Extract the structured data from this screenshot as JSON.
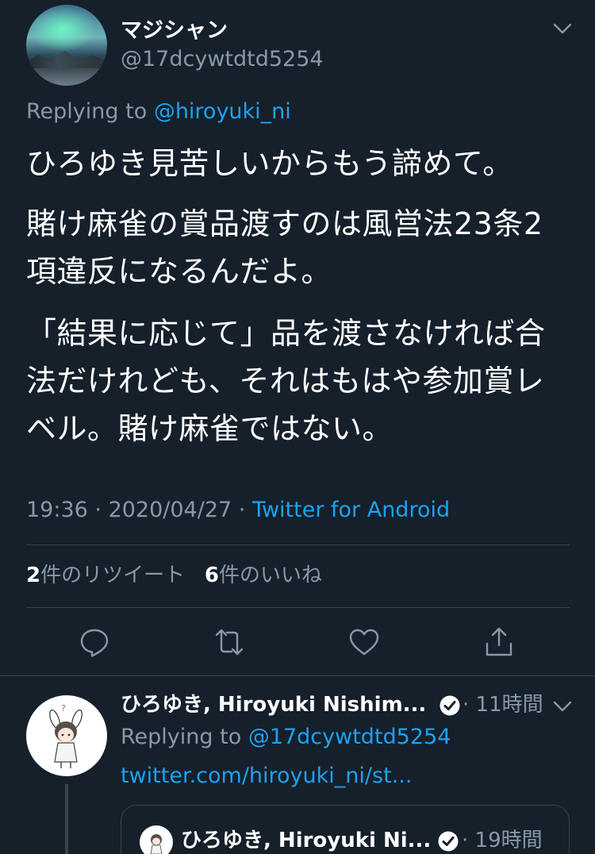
{
  "main_tweet": {
    "display_name": "マジシャン",
    "handle": "@17dcywtdtd5254",
    "replying_prefix": "Replying to ",
    "replying_to": "@hiroyuki_ni",
    "paragraphs": [
      "ひろゆき見苦しいからもう諦めて。",
      "賭け麻雀の賞品渡すのは風営法23条2項違反になるんだよ。",
      "「結果に応じて」品を渡さなければ合法だけれども、それはもはや参加賞レベル。賭け麻雀ではない。"
    ],
    "time": "19:36",
    "date": "2020/04/27",
    "separator": " · ",
    "source": "Twitter for Android",
    "retweet_count": "2",
    "retweet_label": "件のリツイート",
    "like_count": "6",
    "like_label": "件のいいね"
  },
  "actions": [
    "reply-icon",
    "retweet-icon",
    "like-icon",
    "share-icon"
  ],
  "reply_tweet": {
    "display_name": "ひろゆき, Hiroyuki Nishim...",
    "time": "11時間",
    "time_prefix": " · ",
    "replying_prefix": "Replying to ",
    "replying_to": "@17dcywtdtd5254",
    "link_text": "twitter.com/hiroyuki_ni/st...",
    "quote": {
      "display_name": "ひろゆき, Hiroyuki Ni...",
      "time": "19時間",
      "time_prefix": " · "
    }
  },
  "colors": {
    "background": "#15202b",
    "text": "#ffffff",
    "secondary": "#8899a6",
    "link": "#1da1f2",
    "divider": "#38444d"
  }
}
